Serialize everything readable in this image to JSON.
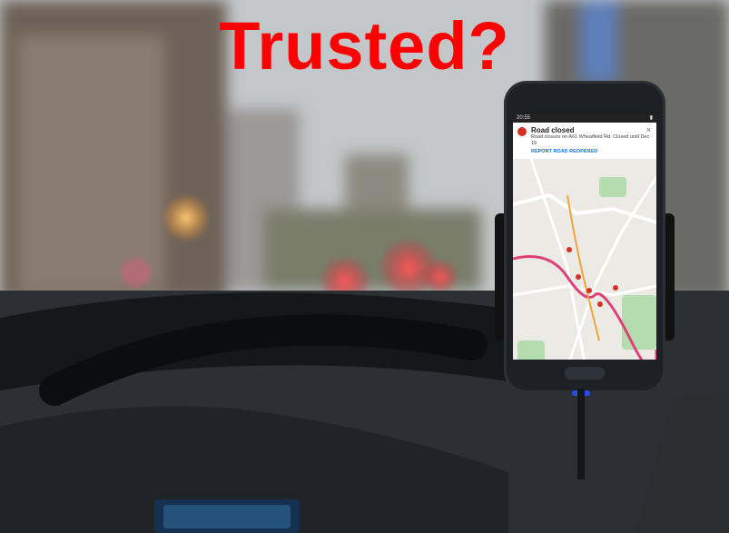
{
  "title": "Trusted?",
  "phone": {
    "status_time": "20:55",
    "notification_title": "Road closed",
    "notification_body": "Road closure on A61 Wheatfield Rd. Closed until Dec 19",
    "notification_action": "REPORT ROAD REOPENED"
  },
  "colors": {
    "title": "#ff0000",
    "closure_marker": "#d93025",
    "route": "#e0407a"
  },
  "icons": [
    "road-closed-icon",
    "close-icon"
  ]
}
